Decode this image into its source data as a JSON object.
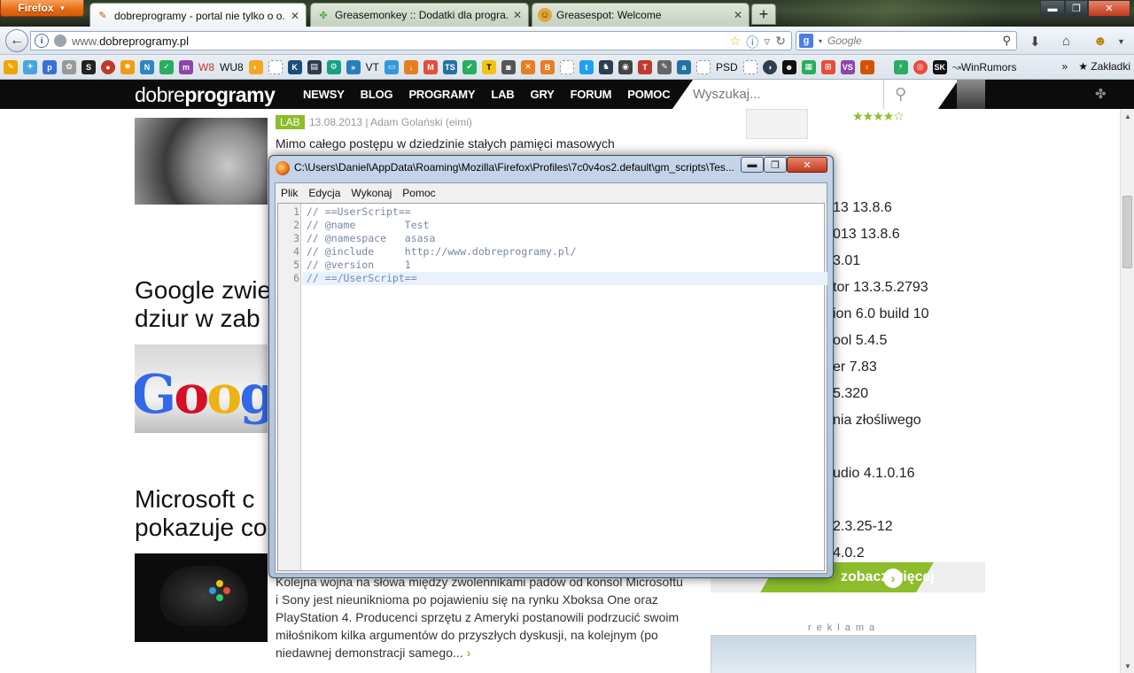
{
  "browser": {
    "app_button": "Firefox",
    "tabs": [
      {
        "title": "dobreprogramy - portal nie tylko o o...",
        "active": true
      },
      {
        "title": "Greasemonkey :: Dodatki dla progra...",
        "active": false
      },
      {
        "title": "Greasespot: Welcome",
        "active": false
      }
    ],
    "new_tab": "+",
    "url_prefix": "www.",
    "url_domain": "dobreprogramy.pl",
    "search_placeholder": "Google",
    "bookmarks": [
      {
        "label": "W8",
        "color": "#c0392b"
      },
      {
        "label": "WU8",
        "color": "#b0b0b0"
      },
      {
        "label": "VT",
        "color": "#1d5fa8"
      },
      {
        "label": "PSD",
        "color": "#333"
      },
      {
        "label": "WinRumors",
        "color": "#555"
      }
    ],
    "bookmarks_menu": "Zakładki",
    "overflow": "»"
  },
  "site": {
    "logo_light": "dobre",
    "logo_bold": "programy",
    "nav": [
      "NEWSY",
      "BLOG",
      "PROGRAMY",
      "LAB",
      "GRY",
      "FORUM",
      "POMOC"
    ],
    "search_placeholder": "Wyszukaj...",
    "article1": {
      "tag": "LAB",
      "meta": "13.08.2013 | Adam Golański (eimi)",
      "text": "Mimo całego postępu w dziedzinie stałych pamięci masowych"
    },
    "headline_google": [
      "Google zwie",
      "dziur w zab"
    ],
    "google_logo": "Google",
    "headline_microsoft": [
      "Microsoft c",
      "pokazuje co"
    ],
    "article3": {
      "lines": [
        "Kolejna wojna na słowa między zwolennikami padów od konsol Microsoftu",
        "i Sony jest nieuniknioma po pojawieniu się na rynku Xboksa One oraz",
        "PlayStation 4. Producenci sprzętu z Ameryki postanowili podrzucić swoim",
        "miłośnikom kilka argumentów do przyszłych dyskusji, na kolejnym (po",
        "niedawnej demonstracji samego..."
      ],
      "more": "›"
    },
    "right_list": [
      "13 13.8.6",
      "013 13.8.6",
      "3.01",
      "tor 13.3.5.2793",
      "ion 6.0 build 10",
      "ool 5.4.5",
      "er 7.83",
      "5.320",
      "nia złośliwego",
      "",
      "udio 4.1.0.16",
      "",
      "2.3.25-12",
      "4.0.2"
    ],
    "rating": "★★★★☆",
    "see_more": "zobacz więcej",
    "ad_label": "reklama"
  },
  "dialog": {
    "title": "C:\\Users\\Daniel\\AppData\\Roaming\\Mozilla\\Firefox\\Profiles\\7c0v4os2.default\\gm_scripts\\Tes...",
    "menu": [
      "Plik",
      "Edycja",
      "Wykonaj",
      "Pomoc"
    ],
    "code": [
      "// ==UserScript==",
      "// @name        Test",
      "// @namespace   asasa",
      "// @include     http://www.dobreprogramy.pl/",
      "// @version     1",
      "// ==/UserScript=="
    ],
    "line_numbers": [
      "1",
      "2",
      "3",
      "4",
      "5",
      "6"
    ]
  }
}
